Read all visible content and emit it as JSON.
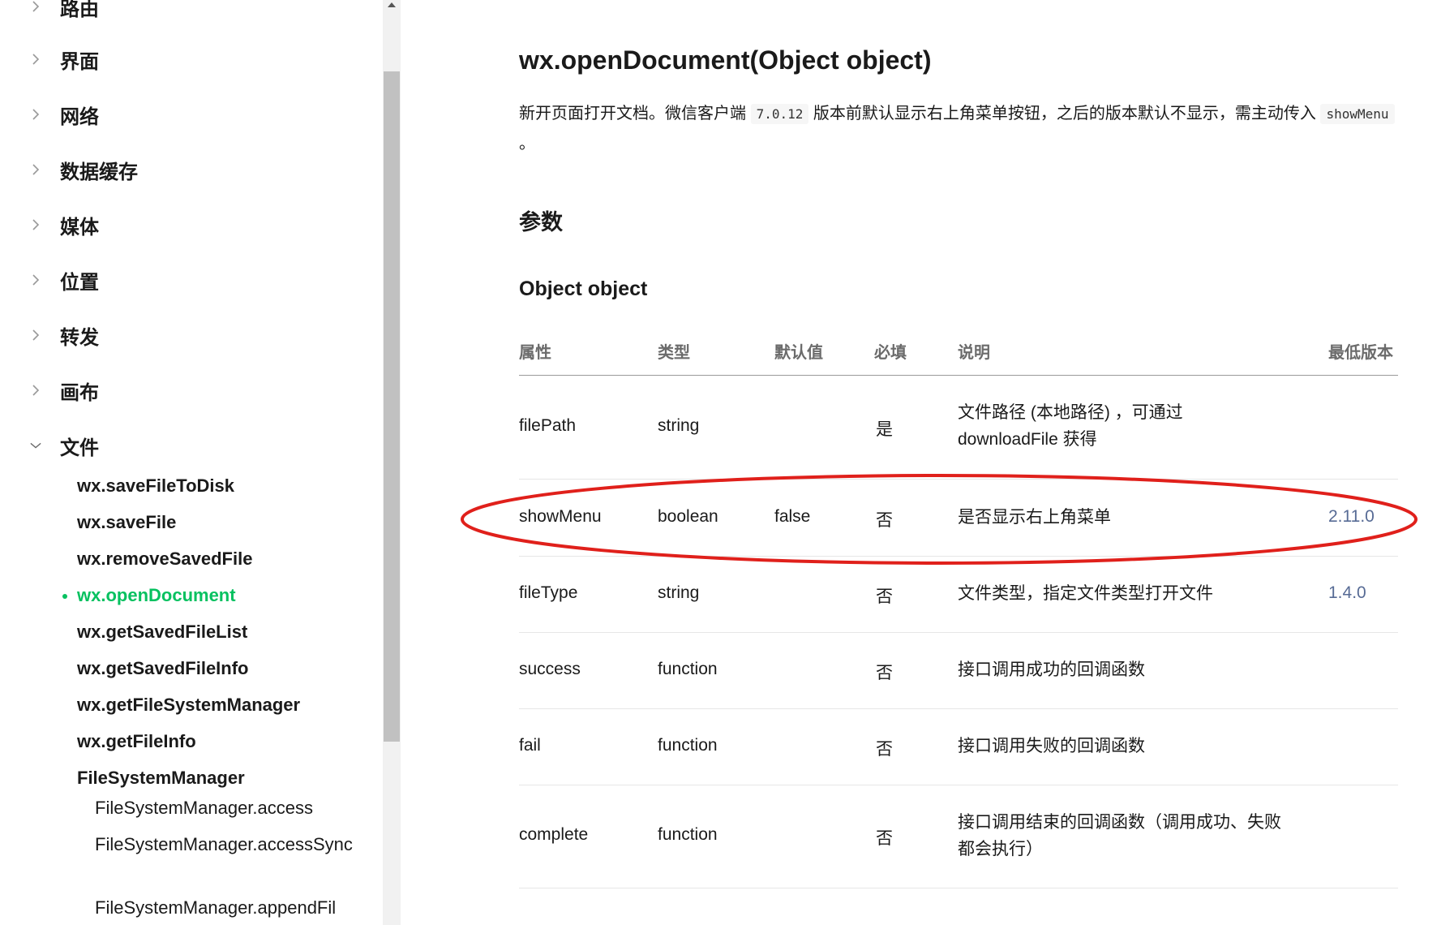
{
  "sidebar": {
    "categories": [
      {
        "label": "路由",
        "expanded": false
      },
      {
        "label": "界面",
        "expanded": false
      },
      {
        "label": "网络",
        "expanded": false
      },
      {
        "label": "数据缓存",
        "expanded": false
      },
      {
        "label": "媒体",
        "expanded": false
      },
      {
        "label": "位置",
        "expanded": false
      },
      {
        "label": "转发",
        "expanded": false
      },
      {
        "label": "画布",
        "expanded": false
      },
      {
        "label": "文件",
        "expanded": true
      }
    ],
    "file_items": [
      "wx.saveFileToDisk",
      "wx.saveFile",
      "wx.removeSavedFile",
      "wx.openDocument",
      "wx.getSavedFileList",
      "wx.getSavedFileInfo",
      "wx.getFileSystemManager",
      "wx.getFileInfo",
      "FileSystemManager"
    ],
    "active_item": "wx.openDocument",
    "fsm_items": [
      "FileSystemManager.access",
      "FileSystemManager.accessSync",
      "FileSystemManager.appendFil"
    ]
  },
  "main": {
    "title": "wx.openDocument(Object object)",
    "desc_part1": "新开页面打开文档。微信客户端 ",
    "desc_code1": "7.0.12",
    "desc_part2": " 版本前默认显示右上角菜单按钮，之后的版本默认不显示，需主动传入 ",
    "desc_code2": "showMenu",
    "desc_part3": " 。",
    "params_heading": "参数",
    "object_heading": "Object object",
    "table": {
      "headers": {
        "attr": "属性",
        "type": "类型",
        "default": "默认值",
        "required": "必填",
        "desc": "说明",
        "version": "最低版本"
      },
      "rows": [
        {
          "attr": "filePath",
          "type": "string",
          "default": "",
          "required": "是",
          "desc": "文件路径 (本地路径) ，可通过 downloadFile 获得",
          "version": ""
        },
        {
          "attr": "showMenu",
          "type": "boolean",
          "default": "false",
          "required": "否",
          "desc": "是否显示右上角菜单",
          "version": "2.11.0"
        },
        {
          "attr": "fileType",
          "type": "string",
          "default": "",
          "required": "否",
          "desc": "文件类型，指定文件类型打开文件",
          "version": "1.4.0"
        },
        {
          "attr": "success",
          "type": "function",
          "default": "",
          "required": "否",
          "desc": "接口调用成功的回调函数",
          "version": ""
        },
        {
          "attr": "fail",
          "type": "function",
          "default": "",
          "required": "否",
          "desc": "接口调用失败的回调函数",
          "version": ""
        },
        {
          "attr": "complete",
          "type": "function",
          "default": "",
          "required": "否",
          "desc": "接口调用结束的回调函数（调用成功、失败都会执行）",
          "version": ""
        }
      ]
    }
  },
  "colors": {
    "active": "#07c160",
    "version_link": "#576b95",
    "annotation": "#e0201b"
  },
  "icons": {
    "collapsed": "chevron-right-icon",
    "expanded": "chevron-down-icon"
  }
}
